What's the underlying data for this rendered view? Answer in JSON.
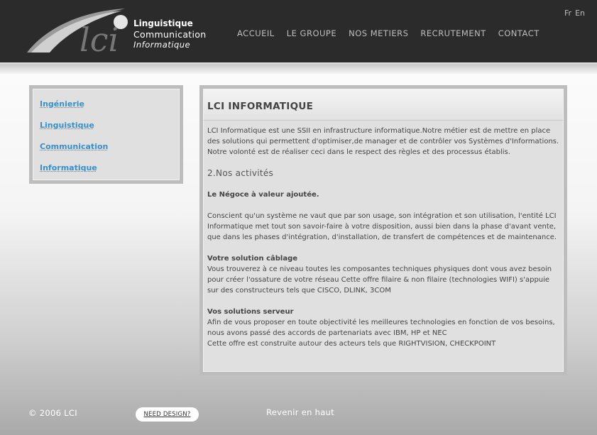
{
  "header": {
    "logo": {
      "mark": "lci",
      "line1": "Linguistique",
      "line2": "Communication",
      "line3": "Informatique"
    },
    "nav": [
      {
        "label": "ACCUEIL"
      },
      {
        "label": "LE GROUPE"
      },
      {
        "label": "NOS METIERS"
      },
      {
        "label": "RECRUTEMENT"
      },
      {
        "label": "CONTACT"
      }
    ],
    "lang": [
      {
        "label": "Fr"
      },
      {
        "label": "En"
      }
    ]
  },
  "sidebar": {
    "items": [
      {
        "label": "Ingénierie"
      },
      {
        "label": "Linguistique"
      },
      {
        "label": "Communication"
      },
      {
        "label": "Informatique"
      }
    ]
  },
  "main": {
    "title": "LCI INFORMATIQUE",
    "intro": "LCI Informatique est une SSII en infrastructure informatique.Notre métier est de mettre en place des solutions  qui permettent d'optimiser,de manager et de contrôler vos Systèmes d'Informations. Notre volonté est de réaliser ceci dans le respect des règles et des processus établis.",
    "section_title": "2.Nos activités",
    "negoce_title": "Le Négoce à valeur ajoutée.",
    "negoce_text": "Conscient qu'un système ne vaut que par son usage, son intégration et son utilisation, l'entité LCI Informatique met tout son savoir-faire à votre disposition, aussi bien dans la phase d'avant vente, que dans les phases d'intégration, d'installation, de transfert de compétences et de maintenance.",
    "cablage_title": "Votre solution câblage",
    "cablage_text": "Vous trouverez à ce niveau toutes les composantes techniques physiques dont vous avez besoin pour créer l'ossature de votre réseau Cette offre filaire & non filaire (technologies WIFI) s'appuie sur des constructeurs tels que CISCO, DLINK, 3COM",
    "serveur_title": "Vos solutions serveur",
    "serveur_text1": "Afin de vous proposer en toute objectivité les meilleures technologies en fonction de vos besoins, nous avons passé des accords de partenariats avec IBM, HP et NEC",
    "serveur_text2": "Cette offre est construite autour des acteurs tels que RIGHTVISION, CHECKPOINT"
  },
  "footer": {
    "copyright": "© 2006 LCI",
    "need_design": "NEED DESIGN?",
    "back_to_top": "Revenir en haut"
  }
}
